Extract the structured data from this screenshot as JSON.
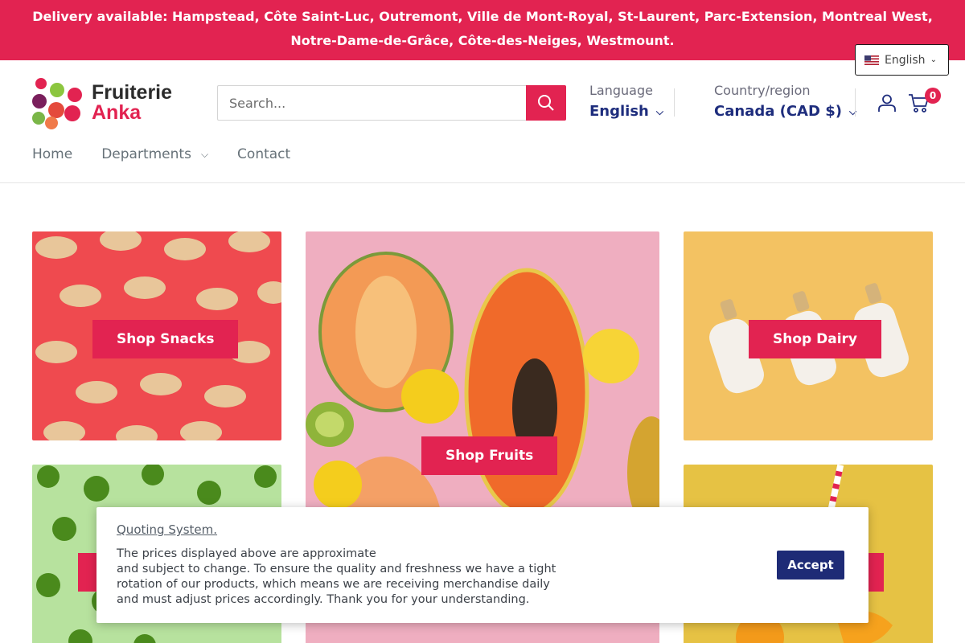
{
  "announcement": {
    "text": "Delivery available: Hampstead, Côte Saint-Luc, Outremont, Ville de Mont-Royal, St-Laurent, Parc-Extension, Montreal West, Notre-Dame-de-Grâce, Côte-des-Neiges, Westmount."
  },
  "language_pill": {
    "label": "English",
    "flag": "us-flag-icon"
  },
  "header": {
    "logo": {
      "line1": "Fruiterie",
      "line2": "Anka"
    },
    "search": {
      "placeholder": "Search..."
    },
    "language": {
      "label": "Language",
      "value": "English"
    },
    "country": {
      "label": "Country/region",
      "value": "Canada (CAD $)"
    },
    "cart_count": "0",
    "icons": [
      "search-icon",
      "account-icon",
      "cart-icon"
    ]
  },
  "nav": {
    "items": [
      {
        "label": "Home"
      },
      {
        "label": "Departments"
      },
      {
        "label": "Contact"
      }
    ]
  },
  "tiles": {
    "snacks": {
      "button": "Shop Snacks"
    },
    "fruits": {
      "button": "Shop Fruits"
    },
    "dairy": {
      "button": "Shop Dairy"
    }
  },
  "cookie": {
    "title": "Quoting System.",
    "text": "The prices displayed above are approximate\nand subject to change. To ensure the quality and freshness we have a tight rotation of our products, which means we are receiving merchandise daily and must adjust prices accordingly. Thank you for your understanding.",
    "accept": "Accept"
  },
  "colors": {
    "brand": "#e22351",
    "navy": "#1e2d7d",
    "accept_button": "#1e2b76"
  }
}
